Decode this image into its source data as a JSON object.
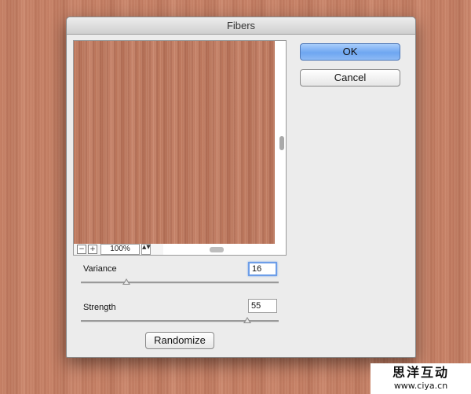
{
  "dialog": {
    "title": "Fibers",
    "ok_label": "OK",
    "cancel_label": "Cancel",
    "randomize_label": "Randomize"
  },
  "preview": {
    "zoom_out_label": "−",
    "zoom_in_label": "+",
    "zoom_level": "100%",
    "zoom_stepper_label": "▲▼"
  },
  "controls": {
    "variance": {
      "label": "Variance",
      "value": "16",
      "slider_fraction": 0.23
    },
    "strength": {
      "label": "Strength",
      "value": "55",
      "slider_fraction": 0.84
    }
  },
  "watermark": {
    "text": "思洋互动",
    "url": "www.ciya.cn"
  },
  "colors": {
    "wood": "#c98469",
    "default_button": "#6ea6f1"
  }
}
